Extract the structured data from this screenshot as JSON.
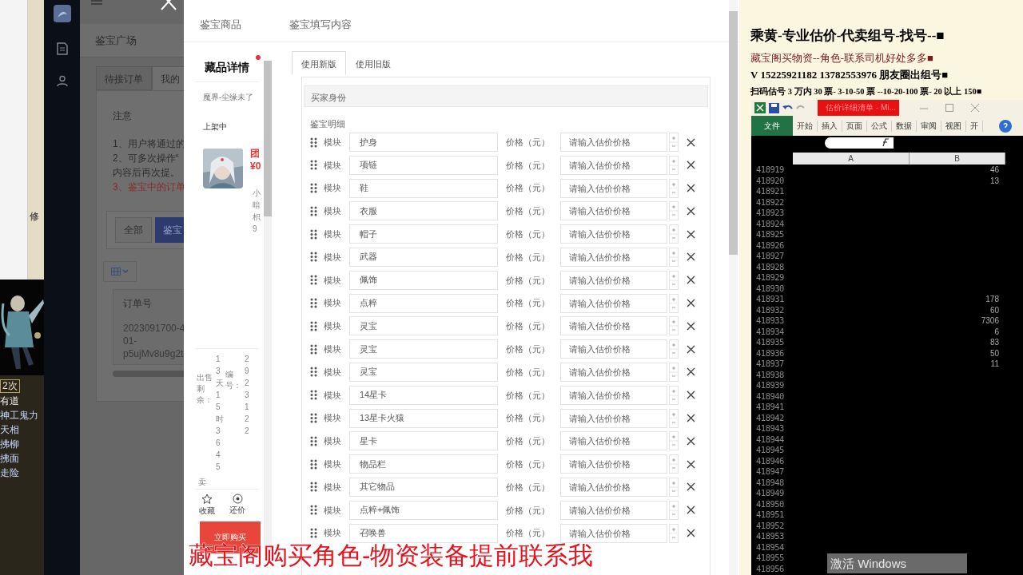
{
  "game_window": {
    "side_text": "修",
    "list": [
      {
        "text": "2次",
        "kind": "badge"
      },
      {
        "text": "有道",
        "kind": "white"
      },
      {
        "text": "神工鬼力",
        "kind": "blue"
      },
      {
        "text": "天相",
        "kind": "blue"
      },
      {
        "text": "拂柳",
        "kind": "blue"
      },
      {
        "text": "拂面",
        "kind": "blue"
      },
      {
        "text": "走险",
        "kind": "blue"
      }
    ]
  },
  "page": {
    "title": "鉴宝广场",
    "tabs": [
      {
        "label": "待接订单",
        "selected": false
      },
      {
        "label": "我的",
        "selected": true
      }
    ],
    "notice": {
      "title": "注意",
      "lines": [
        {
          "text": "1、用户将通过的",
          "kind": "normal"
        },
        {
          "text": "2、可多次操作“",
          "kind": "normal"
        },
        {
          "text": "内容后再次提。",
          "kind": "normal"
        },
        {
          "text": "3、鉴宝中的订单",
          "kind": "red"
        }
      ]
    },
    "filters": [
      {
        "label": "全部",
        "selected": false
      },
      {
        "label": "鉴宝",
        "selected": true
      }
    ],
    "table": {
      "columns": [
        "订单号"
      ],
      "rows": [
        {
          "lines": [
            "2023091700-4",
            "01-",
            "p5ujMv8u9g2t"
          ]
        }
      ]
    }
  },
  "modal": {
    "headers": [
      "鉴宝商品",
      "鉴宝填写内容"
    ],
    "product": {
      "title": "藏品详情",
      "name": "魔界-尘缘未了",
      "status": "上架中",
      "price_cut": "团¥0",
      "info_cut": "小暗枳9",
      "remaining_label": "出售剩余：",
      "remaining": "13天15时3645",
      "id_label": "编号：",
      "id": "2923122",
      "sold_label": "卖",
      "actions": [
        {
          "label": "收藏",
          "kind": "star"
        },
        {
          "label": "还价",
          "kind": "bid"
        }
      ],
      "buy": "立即购买"
    },
    "form": {
      "tabs": [
        {
          "label": "使用新版",
          "selected": true
        },
        {
          "label": "使用旧版",
          "selected": false
        }
      ],
      "section": "买家身份",
      "subtitle": "鉴宝明细",
      "rows": [
        {
          "label": "模块",
          "value": "护身",
          "price_label": "价格（元）",
          "placeholder": "请输入估价价格"
        },
        {
          "label": "模块",
          "value": "项链",
          "price_label": "价格（元）",
          "placeholder": "请输入估价价格"
        },
        {
          "label": "模块",
          "value": "鞋",
          "price_label": "价格（元）",
          "placeholder": "请输入估价价格"
        },
        {
          "label": "模块",
          "value": "衣服",
          "price_label": "价格（元）",
          "placeholder": "请输入估价价格"
        },
        {
          "label": "模块",
          "value": "帽子",
          "price_label": "价格（元）",
          "placeholder": "请输入估价价格"
        },
        {
          "label": "模块",
          "value": "武器",
          "price_label": "价格（元）",
          "placeholder": "请输入估价价格"
        },
        {
          "label": "模块",
          "value": "佩饰",
          "price_label": "价格（元）",
          "placeholder": "请输入估价价格"
        },
        {
          "label": "模块",
          "value": "点粹",
          "price_label": "价格（元）",
          "placeholder": "请输入估价价格"
        },
        {
          "label": "模块",
          "value": "灵宝",
          "price_label": "价格（元）",
          "placeholder": "请输入估价价格"
        },
        {
          "label": "模块",
          "value": "灵宝",
          "price_label": "价格（元）",
          "placeholder": "请输入估价价格"
        },
        {
          "label": "模块",
          "value": "灵宝",
          "price_label": "价格（元）",
          "placeholder": "请输入估价价格"
        },
        {
          "label": "模块",
          "value": "14星卡",
          "price_label": "价格（元）",
          "placeholder": "请输入估价价格"
        },
        {
          "label": "模块",
          "value": "13星卡火猿",
          "price_label": "价格（元）",
          "placeholder": "请输入估价价格"
        },
        {
          "label": "模块",
          "value": "星卡",
          "price_label": "价格（元）",
          "placeholder": "请输入估价价格"
        },
        {
          "label": "模块",
          "value": "物品栏",
          "price_label": "价格（元）",
          "placeholder": "请输入估价价格"
        },
        {
          "label": "模块",
          "value": "其它物品",
          "price_label": "价格（元）",
          "placeholder": "请输入估价价格"
        },
        {
          "label": "模块",
          "value": "点粹+佩饰",
          "price_label": "价格（元）",
          "placeholder": "请输入估价价格"
        },
        {
          "label": "模块",
          "value": "召唤兽",
          "price_label": "价格（元）",
          "placeholder": "请输入估价价格"
        }
      ]
    }
  },
  "notes": [
    {
      "text": "乘黄-专业估价-代卖组号-找号--■",
      "kind": "headline"
    },
    {
      "text": "藏宝阁买物资--角色-联系司机好处多多■",
      "kind": "red"
    },
    {
      "text": "V 15225921182    13782553976 朋友圈出组号■",
      "kind": "bold"
    },
    {
      "text": "扫码估号 3 万内 30 票- 3-10-50 票 --10-20-100 票- 20 以上 150■",
      "kind": "small"
    }
  ],
  "excel": {
    "title": "估价详细清单 - Mi...",
    "ribbon_tabs": [
      {
        "label": "文件",
        "selected": true
      },
      {
        "label": "开始",
        "selected": false
      },
      {
        "label": "插入",
        "selected": false
      },
      {
        "label": "页面",
        "selected": false
      },
      {
        "label": "公式",
        "selected": false
      },
      {
        "label": "数据",
        "selected": false
      },
      {
        "label": "审阅",
        "selected": false
      },
      {
        "label": "视图",
        "selected": false
      },
      {
        "label": "开",
        "selected": false
      }
    ],
    "columns": [
      "A",
      "B"
    ],
    "rows": [
      {
        "num": "418919",
        "b": "46"
      },
      {
        "num": "418920",
        "b": "13"
      },
      {
        "num": "418921"
      },
      {
        "num": "418922"
      },
      {
        "num": "418923"
      },
      {
        "num": "418924"
      },
      {
        "num": "418925"
      },
      {
        "num": "418926"
      },
      {
        "num": "418927"
      },
      {
        "num": "418928"
      },
      {
        "num": "418929"
      },
      {
        "num": "418930"
      },
      {
        "num": "418931",
        "b": "178"
      },
      {
        "num": "418932",
        "b": "60"
      },
      {
        "num": "418933",
        "b": "7306"
      },
      {
        "num": "418934",
        "b": "6"
      },
      {
        "num": "418935",
        "b": "83"
      },
      {
        "num": "418936",
        "b": "50"
      },
      {
        "num": "418937",
        "b": "11"
      },
      {
        "num": "418938"
      },
      {
        "num": "418939"
      },
      {
        "num": "418940"
      },
      {
        "num": "418941"
      },
      {
        "num": "418942"
      },
      {
        "num": "418943"
      },
      {
        "num": "418944"
      },
      {
        "num": "418945"
      },
      {
        "num": "418946"
      },
      {
        "num": "418947"
      },
      {
        "num": "418948"
      },
      {
        "num": "418949"
      },
      {
        "num": "418950"
      },
      {
        "num": "418951"
      },
      {
        "num": "418952"
      },
      {
        "num": "418953"
      },
      {
        "num": "418954"
      },
      {
        "num": "418955"
      },
      {
        "num": "418956"
      }
    ]
  },
  "caption": "藏宝阁购买角色-物资装备提前联系我",
  "activation": "激活 Windows"
}
